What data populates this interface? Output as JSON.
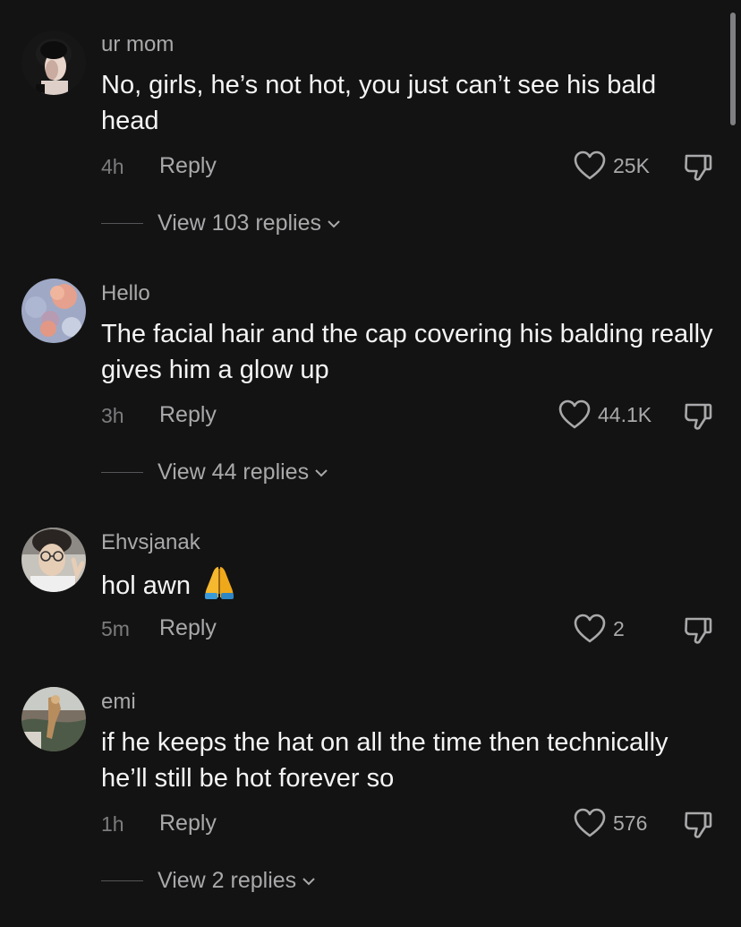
{
  "comments": [
    {
      "username": "ur mom",
      "text": "No, girls, he’s not hot, you just can’t see his bald head",
      "time": "4h",
      "reply_label": "Reply",
      "likes": "25K",
      "view_replies": "View 103 replies"
    },
    {
      "username": "Hello",
      "text": "The facial hair and the cap covering his balding really gives him a glow up",
      "time": "3h",
      "reply_label": "Reply",
      "likes": "44.1K",
      "view_replies": "View 44 replies"
    },
    {
      "username": "Ehvsjanak",
      "text": "hol awn",
      "emoji": "folded-hands",
      "time": "5m",
      "reply_label": "Reply",
      "likes": "2"
    },
    {
      "username": "emi",
      "text": "if he keeps the hat on all the time then technically he’ll still be hot forever so",
      "time": "1h",
      "reply_label": "Reply",
      "likes": "576",
      "view_replies": "View 2 replies"
    }
  ],
  "colors": {
    "background": "#131313",
    "text": "#f4f4f4",
    "secondary": "#a9a9ab",
    "muted": "#7c7c7e"
  }
}
